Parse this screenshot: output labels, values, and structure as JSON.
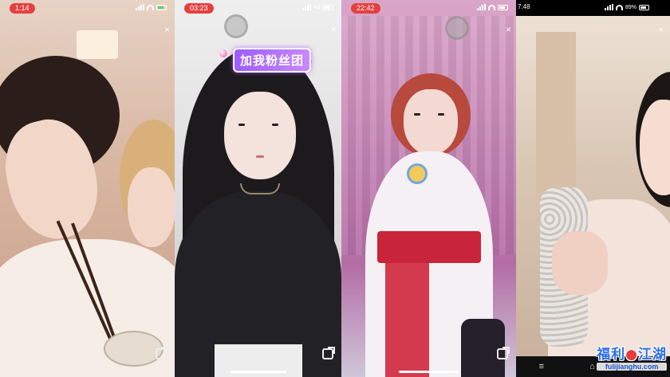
{
  "panels": [
    {
      "time": "1:14"
    },
    {
      "time": "03:23",
      "network": "4G",
      "banner": "加我粉丝团"
    },
    {
      "time": "22:42"
    },
    {
      "time": "7:48",
      "battery": "89%"
    }
  ],
  "close_glyph": "×",
  "watermark": {
    "cn_left": "福利",
    "cn_right": "江湖",
    "url": "fulijianghu.com"
  },
  "nav4": {
    "menu": "≡",
    "home": "⌂",
    "back": "◁"
  },
  "colors": {
    "time_pill": "#e54040",
    "banner": "#9c5cff",
    "watermark_blue": "#2b6de8",
    "watermark_red": "#e53b3b"
  },
  "icons": [
    "signal-icon",
    "wifi-icon",
    "battery-icon",
    "close-icon",
    "share-icon",
    "floating-button-icon"
  ]
}
